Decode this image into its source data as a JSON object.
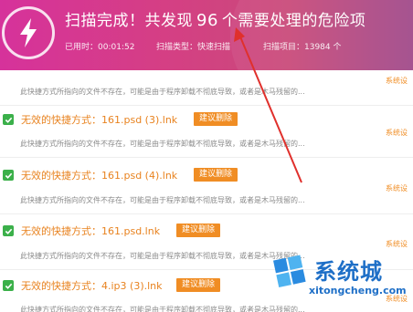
{
  "header": {
    "title_prefix": "扫描完成！共发现",
    "title_count": "96",
    "title_suffix": "个需要处理的危险项",
    "elapsed": "已用时：00:01:52",
    "scan_type": "扫描类型：快速扫描",
    "scan_items": "扫描项目：13984 个",
    "colors": {
      "gradient_start": "#d6329b",
      "gradient_end": "#a04a8a",
      "arrow": "#e0302c"
    }
  },
  "items": [
    {
      "desc": "此快捷方式所指向的文件不存在，可能是由于程序卸载不彻底导致，或者是木马残留的...",
      "side": "系统设",
      "title": null,
      "button": null
    },
    {
      "title": "无效的快捷方式：161.psd (3).lnk",
      "button": "建议删除",
      "desc": "此快捷方式所指向的文件不存在，可能是由于程序卸载不彻底导致，或者是木马残留的...",
      "side": "系统设"
    },
    {
      "title": "无效的快捷方式：161.psd (4).lnk",
      "button": "建议删除",
      "desc": "此快捷方式所指向的文件不存在，可能是由于程序卸载不彻底导致，或者是木马残留的...",
      "side": "系统设"
    },
    {
      "title": "无效的快捷方式：161.psd.lnk",
      "button": "建议删除",
      "desc": "此快捷方式所指向的文件不存在，可能是由于程序卸载不彻底导致，或者是木马残留的...",
      "side": "系统设"
    },
    {
      "title": "无效的快捷方式：4.ip3 (3).lnk",
      "button": "建议删除",
      "desc": "此快捷方式所指向的文件不存在，可能是由于程序卸载不彻底导致，或者是木马残留的...",
      "side": "系统设"
    }
  ],
  "watermark": {
    "brand": "系统城",
    "url": "xitongcheng.com"
  },
  "icons": {
    "logo": "lightning-icon",
    "check": "checkbox-checked-icon",
    "watermark": "windows-logo-icon"
  },
  "colors": {
    "accent": "#f08d24",
    "check": "#3bb04a",
    "title_text": "#e8821e",
    "watermark": "#1e6fc7"
  }
}
